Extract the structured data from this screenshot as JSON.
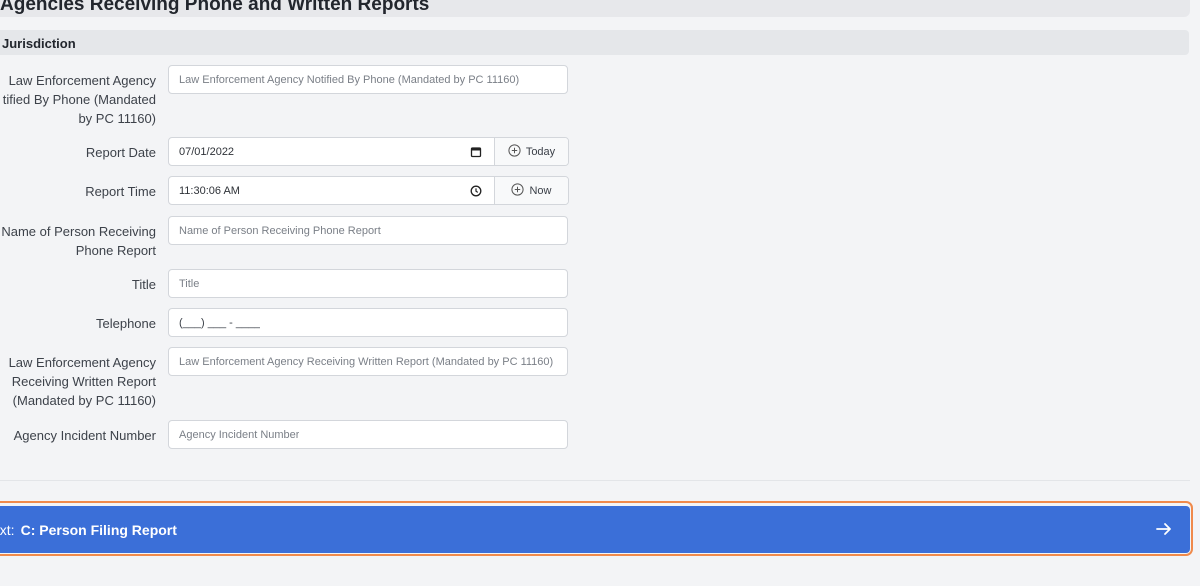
{
  "section": {
    "title": "Agencies Receiving Phone and Written Reports"
  },
  "subsection": {
    "title": "Jurisdiction"
  },
  "fields": {
    "phone_agency": {
      "label_line1": "Law Enforcement Agency",
      "label_line2": "tified By Phone (Mandated",
      "label_line3": "by PC 11160)",
      "placeholder": "Law Enforcement Agency Notified By Phone (Mandated by PC 11160)"
    },
    "report_date": {
      "label": "Report Date",
      "value": "07/01/2022",
      "button": "Today"
    },
    "report_time": {
      "label": "Report Time",
      "value": "11:30:06 AM",
      "button": "Now"
    },
    "person_receiving": {
      "label_line1": "Name of Person Receiving",
      "label_line2": "Phone Report",
      "placeholder": "Name of Person Receiving Phone Report"
    },
    "title": {
      "label": "Title",
      "placeholder": "Title"
    },
    "telephone": {
      "label": "Telephone",
      "placeholder": "(___) ___ - ____"
    },
    "written_agency": {
      "label_line1": "Law Enforcement Agency",
      "label_line2": "Receiving Written Report",
      "label_line3": "(Mandated by PC 11160)",
      "placeholder": "Law Enforcement Agency Receiving Written Report (Mandated by PC 11160)"
    },
    "incident_number": {
      "label": "Agency Incident Number",
      "placeholder": "Agency Incident Number"
    }
  },
  "next": {
    "prefix": "ext:",
    "target": "C: Person Filing Report"
  }
}
